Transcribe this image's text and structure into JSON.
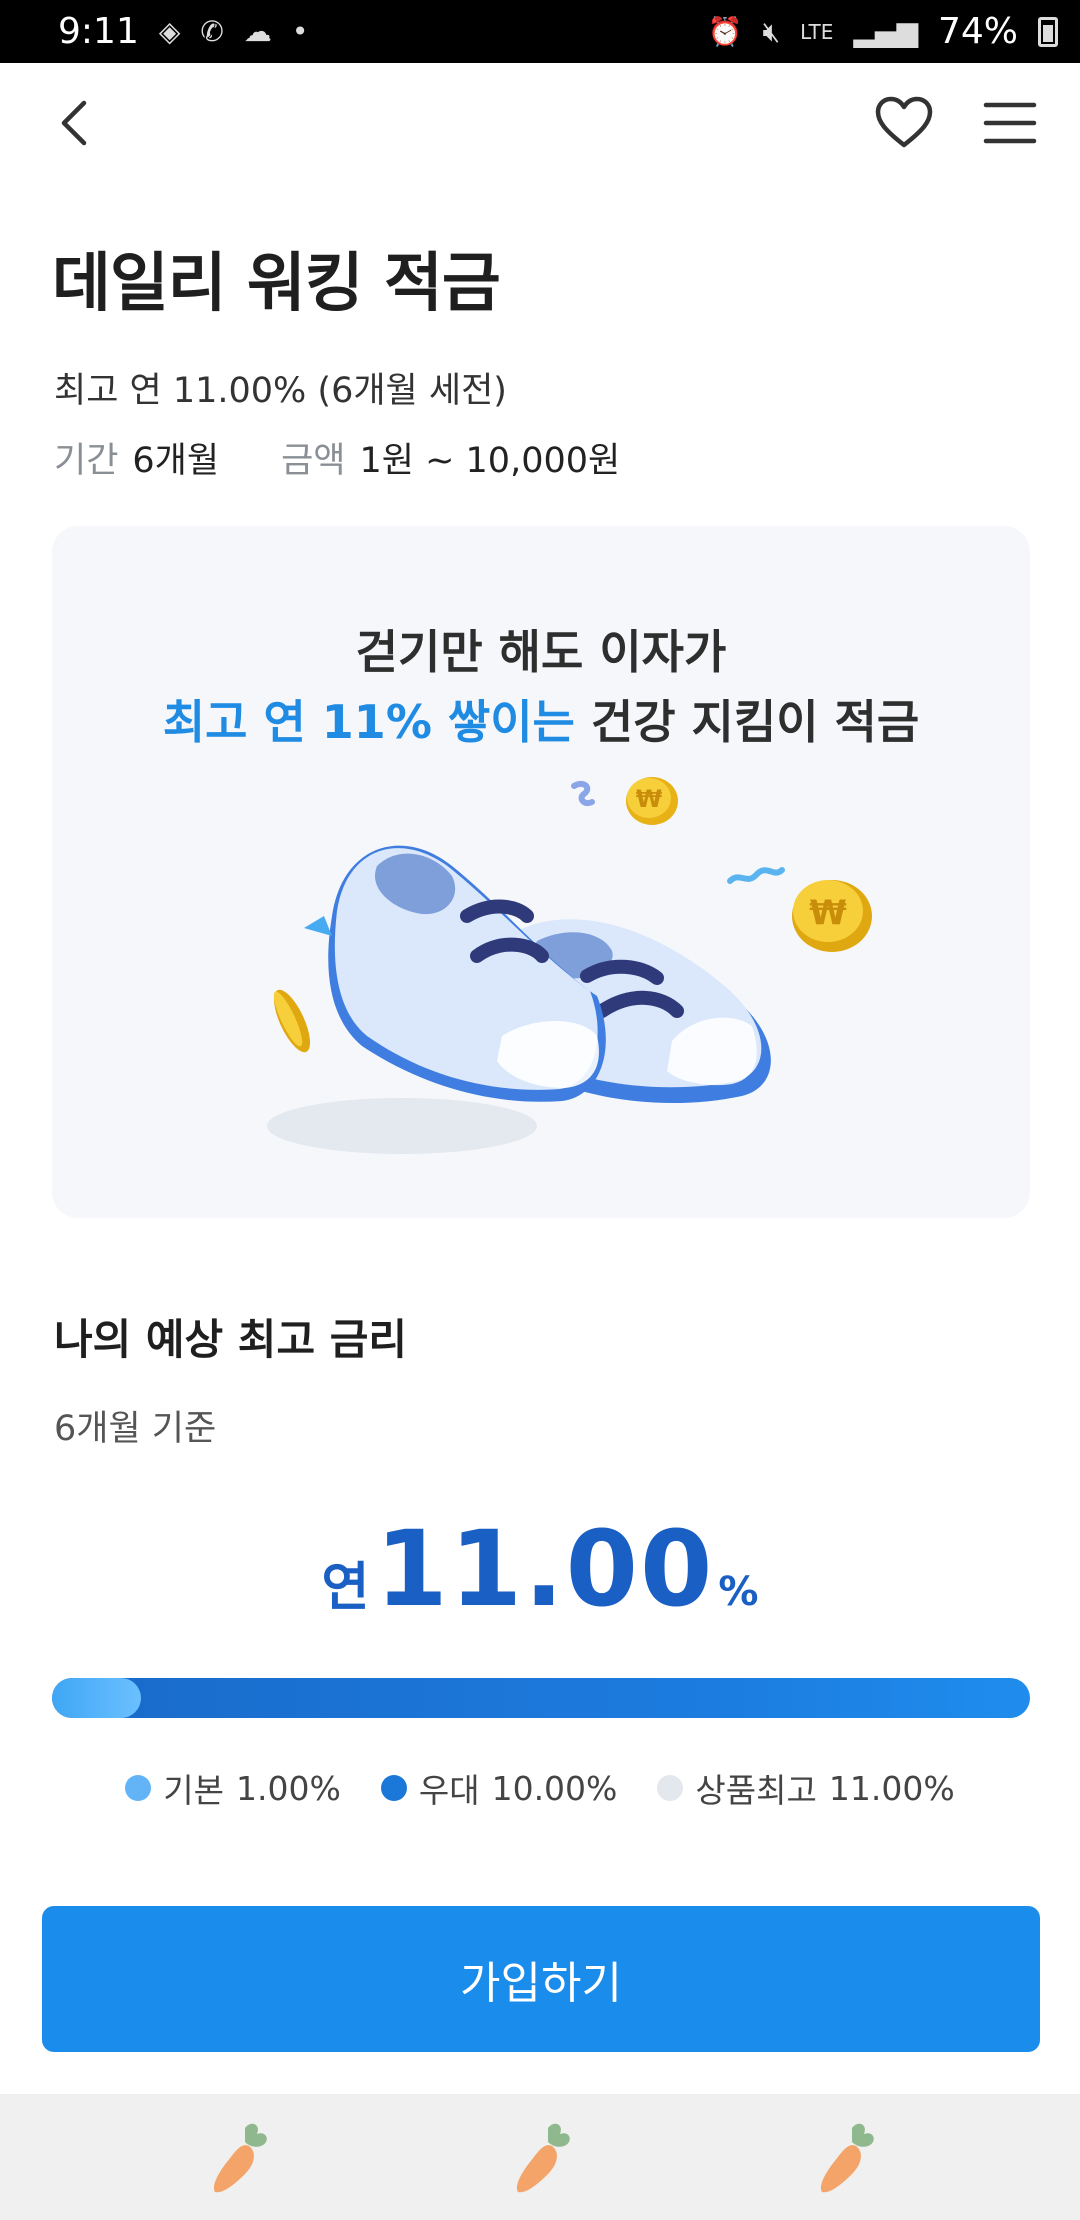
{
  "status_bar": {
    "time": "9:11",
    "network": "LTE",
    "battery": "74%",
    "icons": [
      "pill-icon",
      "volte-icon",
      "cloud-icon",
      "dot-icon",
      "alarm-icon",
      "mute-icon",
      "signal-icon",
      "battery-icon"
    ]
  },
  "nav": {
    "icons": [
      "back-arrow-icon",
      "heart-icon",
      "hamburger-menu-icon"
    ]
  },
  "product": {
    "title": "데일리 워킹 적금",
    "subtitle": "최고 연 11.00% (6개월 세전)",
    "period_label": "기간",
    "period_value": "6개월",
    "amount_label": "금액",
    "amount_value": "1원 ~ 10,000원"
  },
  "banner": {
    "line1": "걷기만 해도 이자가",
    "line2_highlight": "최고 연 11% 쌓이는",
    "line2_rest": " 건강 지킴이 적금",
    "illustration": "shoes-coins-illustration"
  },
  "rate_section": {
    "title": "나의 예상 최고 금리",
    "basis": "6개월 기준",
    "prefix": "연",
    "value": "11.00",
    "unit": "%",
    "base_rate_fraction": 0.0909,
    "legend": [
      {
        "label": "기본",
        "value": "1.00%",
        "color": "#62b4f7"
      },
      {
        "label": "우대",
        "value": "10.00%",
        "color": "#1c78d8"
      },
      {
        "label": "상품최고",
        "value": "11.00%",
        "color": "#e3e8ef"
      }
    ]
  },
  "cta": {
    "label": "가입하기",
    "color": "#1a8cec"
  },
  "bottom_bar": {
    "icons": [
      "carrot-icon",
      "carrot-icon",
      "carrot-icon"
    ]
  },
  "colors": {
    "accent": "#1f8be3",
    "rate_text": "#1a5fc4"
  }
}
